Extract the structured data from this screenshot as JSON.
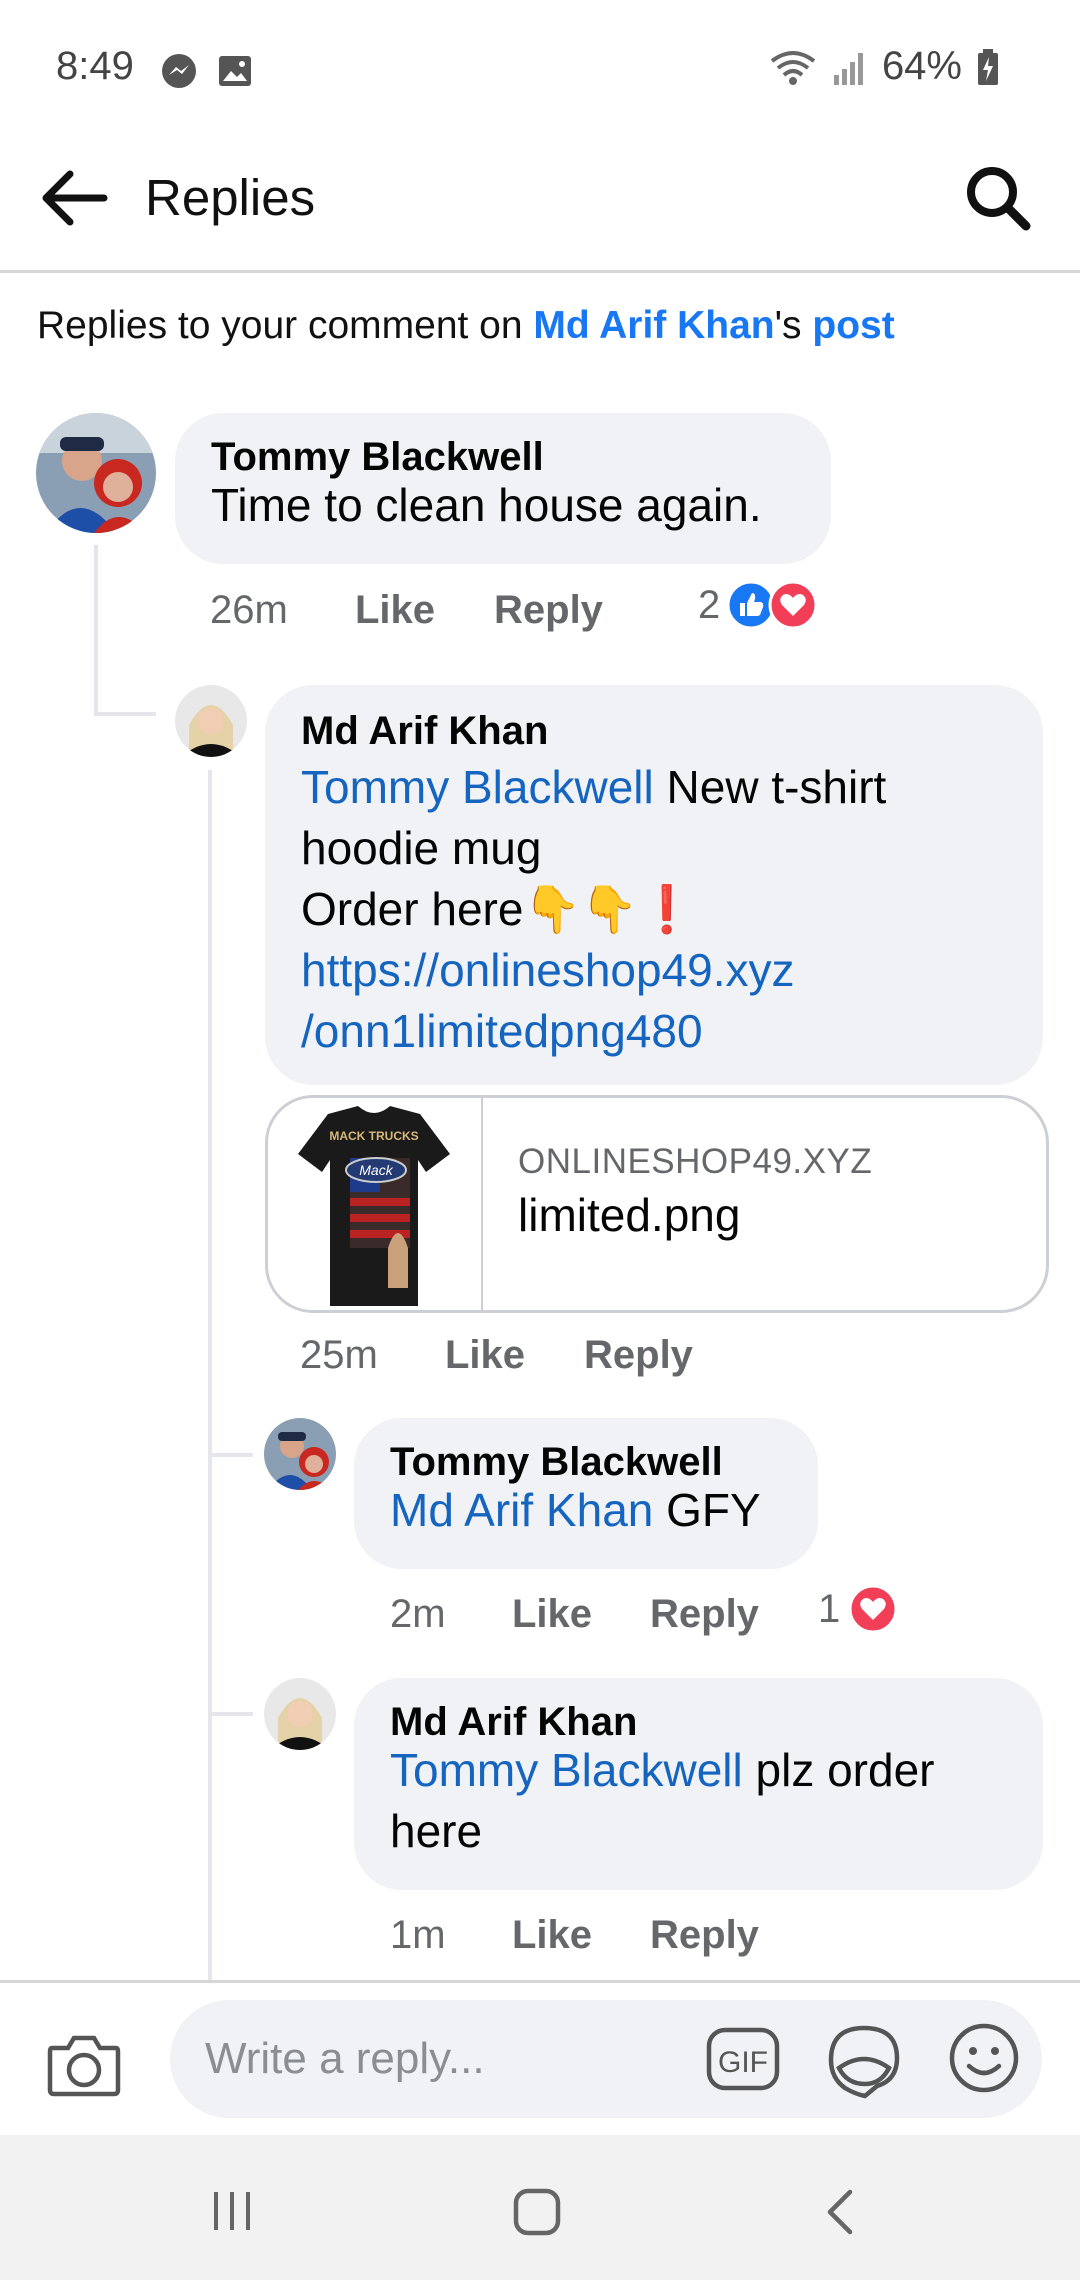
{
  "status": {
    "time": "8:49",
    "battery": "64%"
  },
  "header": {
    "title": "Replies"
  },
  "subheader": {
    "prefix": "Replies to your comment on ",
    "author": "Md Arif Khan",
    "possessive": "'s ",
    "post": "post"
  },
  "comments": [
    {
      "author": "Tommy Blackwell",
      "text": "Time to clean house again.",
      "time": "26m",
      "like": "Like",
      "reply": "Reply",
      "reaction_count": "2"
    },
    {
      "author": "Md Arif Khan",
      "mention": "Tommy Blackwell",
      "text_line1": " New t-shirt",
      "text_line2": "hoodie mug",
      "text_line3": "Order  here",
      "emoji": "👇👇❗",
      "url_line1": "https://onlineshop49.xyz",
      "url_line2": "/onn1limitedpng480",
      "time": "25m",
      "like": "Like",
      "reply": "Reply",
      "preview": {
        "domain": "ONLINESHOP49.XYZ",
        "title": "limited.png",
        "image_text_top": "MACK TRUCKS",
        "image_text_logo": "Mack"
      }
    },
    {
      "author": "Tommy Blackwell",
      "mention": "Md Arif Khan",
      "text": " GFY",
      "time": "2m",
      "like": "Like",
      "reply": "Reply",
      "reaction_count": "1"
    },
    {
      "author": "Md Arif Khan",
      "mention": "Tommy Blackwell",
      "text_line1": " plz order",
      "text_line2": "here",
      "time": "1m",
      "like": "Like",
      "reply": "Reply"
    }
  ],
  "composer": {
    "placeholder": "Write a reply...",
    "gif_label": "GIF"
  },
  "colors": {
    "link": "#1877f2",
    "bubble": "#f0f2f5",
    "like_blue": "#1877f2",
    "love_red": "#f33e58"
  }
}
